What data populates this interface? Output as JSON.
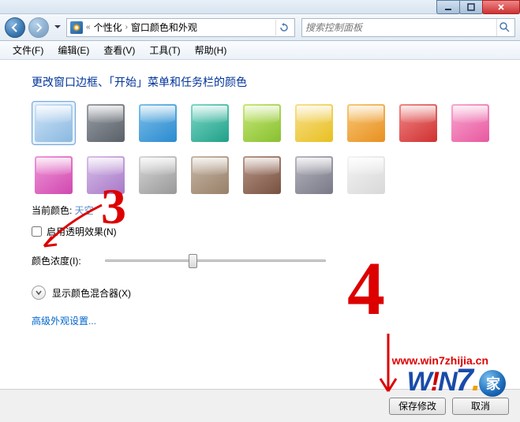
{
  "titlebar": {
    "min": "min",
    "max": "max",
    "close": "close"
  },
  "nav": {
    "back": "back",
    "forward": "forward",
    "chev": "«",
    "crumb1": "个性化",
    "sep": "›",
    "crumb2": "窗口颜色和外观",
    "search_placeholder": "搜索控制面板"
  },
  "menu": {
    "file": "文件(F)",
    "edit": "编辑(E)",
    "view": "查看(V)",
    "tools": "工具(T)",
    "help": "帮助(H)"
  },
  "page": {
    "title": "更改窗口边框、「开始」菜单和任务栏的颜色",
    "current_label": "当前颜色: ",
    "current_value": "天空",
    "transparency_label": "启用透明效果(N)",
    "intensity_label": "颜色浓度(I):",
    "mixer_label": "显示颜色混合器(X)",
    "advanced_link": "高级外观设置..."
  },
  "swatches": [
    {
      "name": "sky",
      "bg": "linear-gradient(145deg,#cfe4f8,#8ab8e0)",
      "selected": true
    },
    {
      "name": "graphite",
      "bg": "linear-gradient(145deg,#9aa0a6,#5a6068)"
    },
    {
      "name": "blue",
      "bg": "linear-gradient(145deg,#7ec0e8,#2a8ad0)"
    },
    {
      "name": "teal",
      "bg": "linear-gradient(145deg,#7ed8c8,#20a088)"
    },
    {
      "name": "green",
      "bg": "linear-gradient(145deg,#c8e878,#88c030)"
    },
    {
      "name": "yellow",
      "bg": "linear-gradient(145deg,#f8e090,#e8c020)"
    },
    {
      "name": "orange",
      "bg": "linear-gradient(145deg,#f8c878,#e89020)"
    },
    {
      "name": "red",
      "bg": "linear-gradient(145deg,#f08888,#d03030)"
    },
    {
      "name": "pink",
      "bg": "linear-gradient(145deg,#f8a8d0,#e858a0)"
    },
    {
      "name": "fuchsia",
      "bg": "linear-gradient(145deg,#f098d8,#d048b0)"
    },
    {
      "name": "lavender",
      "bg": "linear-gradient(145deg,#d8c0e8,#a878c8)"
    },
    {
      "name": "silver",
      "bg": "linear-gradient(145deg,#d8d8d8,#989898)"
    },
    {
      "name": "taupe",
      "bg": "linear-gradient(145deg,#c8b8a8,#988068)"
    },
    {
      "name": "chocolate",
      "bg": "linear-gradient(145deg,#b89888,#785040)"
    },
    {
      "name": "slate",
      "bg": "linear-gradient(145deg,#b8b8c0,#787888)"
    },
    {
      "name": "frost",
      "bg": "linear-gradient(145deg,#f4f4f4,#d8d8d8)"
    }
  ],
  "footer": {
    "save": "保存修改",
    "cancel": "取消"
  },
  "annot": {
    "n3": "3",
    "n4": "4",
    "url": "www.win7zhijia.cn",
    "logo_w": "W",
    "logo_i": "!",
    "logo_n": "N",
    "logo_7": "7",
    "logo_dot": ".",
    "logo_jia": "家"
  }
}
